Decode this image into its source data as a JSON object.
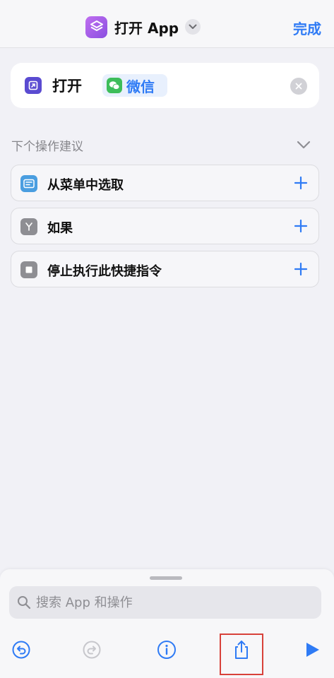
{
  "navbar": {
    "title": "打开 App",
    "done_label": "完成"
  },
  "action": {
    "verb": "打开",
    "app_name": "微信"
  },
  "suggestions": {
    "header": "下个操作建议",
    "items": [
      {
        "label": "从菜单中选取",
        "icon": "menu-icon",
        "color": "#4a9ee0"
      },
      {
        "label": "如果",
        "icon": "branch-icon",
        "color": "#8e8e93"
      },
      {
        "label": "停止执行此快捷指令",
        "icon": "stop-icon",
        "color": "#8e8e93"
      }
    ]
  },
  "search": {
    "placeholder": "搜索 App 和操作"
  },
  "toolbar": {
    "items": [
      "undo-icon",
      "redo-icon",
      "info-icon",
      "share-icon",
      "play-icon"
    ]
  },
  "colors": {
    "accent": "#2f7bf5",
    "shortcut_icon": "#a65be8",
    "open_app_icon": "#5a4bd1",
    "wechat": "#3dbd5a",
    "highlight": "#d8413a"
  }
}
